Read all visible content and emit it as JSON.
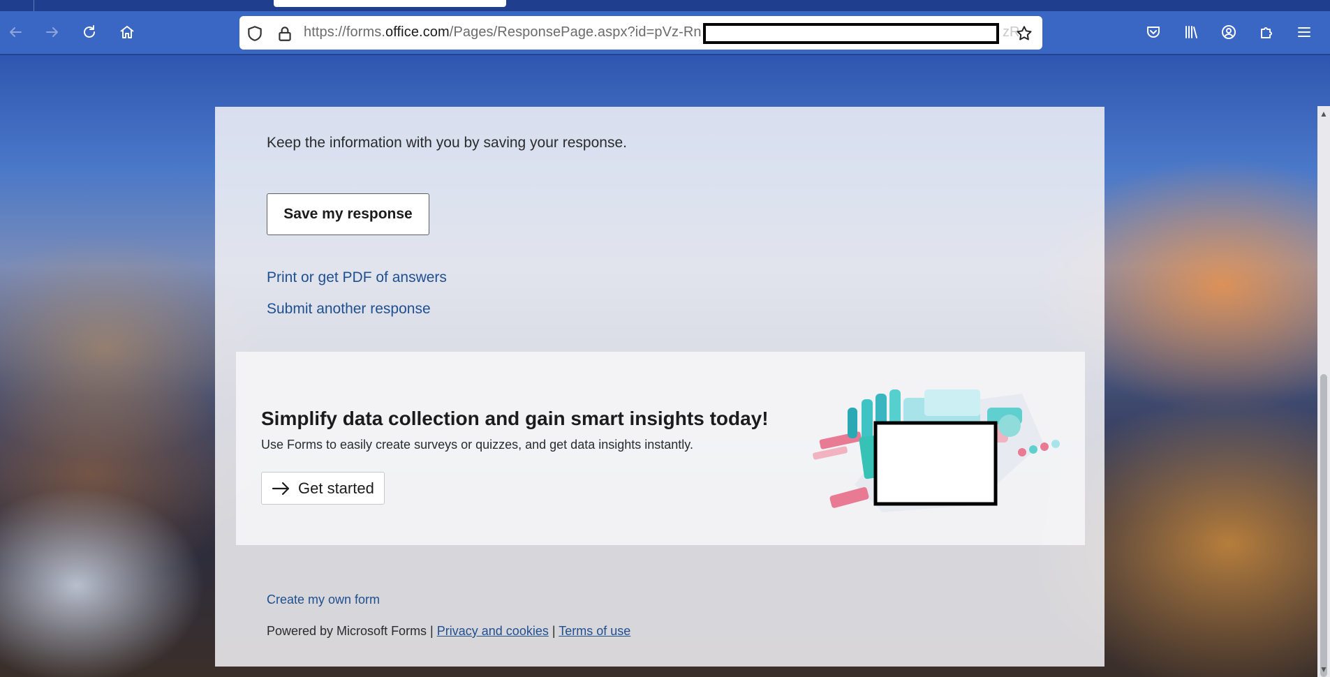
{
  "browser": {
    "url_prefix": "https://forms.",
    "url_host": "office.com",
    "url_path": "/Pages/ResponsePage.aspx?id=pVz-Rn",
    "url_tail": "zR",
    "icons": {
      "back": "back-arrow-icon",
      "forward": "forward-arrow-icon",
      "reload": "reload-icon",
      "home": "home-icon",
      "site_info": "shield-icon",
      "lock": "lock-icon",
      "bookmark": "star-icon",
      "pocket": "pocket-icon",
      "library": "library-icon",
      "account": "account-icon",
      "extensions": "puzzle-icon",
      "menu": "hamburger-menu-icon"
    }
  },
  "response": {
    "save_hint": "Keep the information with you by saving your response.",
    "save_button": "Save my response",
    "print_link": "Print or get PDF of answers",
    "submit_another_link": "Submit another response"
  },
  "promo": {
    "heading": "Simplify data collection and gain smart insights today!",
    "subtext": "Use Forms to easily create surveys or quizzes, and get data insights instantly.",
    "get_started": "Get started"
  },
  "footer": {
    "create_link": "Create my own form",
    "powered_by": "Powered by Microsoft Forms |",
    "privacy": "Privacy and cookies",
    "sep": "|",
    "terms": "Terms of use"
  },
  "colors": {
    "toolbar": "#3a66c4",
    "link": "#1f4f8f",
    "card": "#f2f2f6"
  }
}
